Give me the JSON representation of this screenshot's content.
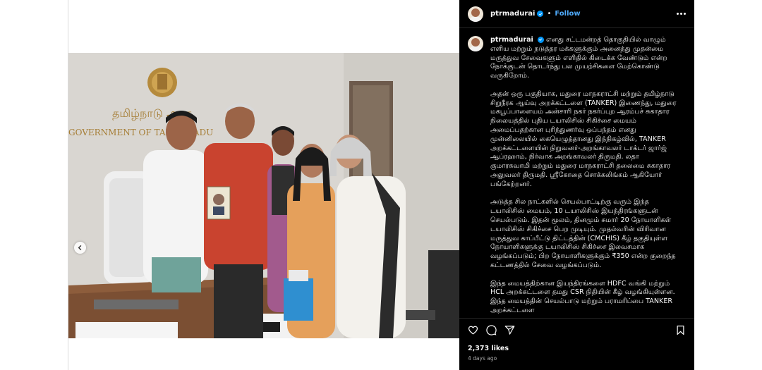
{
  "post": {
    "username": "ptrmadurai",
    "follow_label": "Follow",
    "separator": "•",
    "more_label": "More options"
  },
  "photo": {
    "wall_sign_tamil": "தமிழ்நாடு அரசு",
    "wall_sign_english": "GOVERNMENT OF TAMIL NADU"
  },
  "caption": {
    "username": "ptrmadurai",
    "paragraphs": [
      "எனது சட்டமன்றத் தொகுதியில் வாழும் எளிய மற்றும் நடுத்தர மக்களுக்கும் அனைத்து முதன்மை மருத்துவ சேவைகளும் எளிதில் கிடைக்க வேண்டும் என்ற நோக்குடன் தொடர்ந்து பல முயற்சிகளை மேற்கொண்டு வருகிறோம்.",
      "அதன் ஒரு பகுதியாக, மதுரை மாநகராட்சி மற்றும் தமிழ்நாடு சிறுநீரக ஆய்வு அறக்கட்டளை (TANKER) இணைந்து, மதுரை மகபூப்பாளையம் அன்சாரி நகர் நகர்ப்புற ஆரம்பச் சுகாதார நிலையத்தில் புதிய டயாலிசிஸ் சிகிச்சை மையம் அமைப்பதற்கான புரிந்துணர்வு ஒப்பந்தம் எனது முன்னிலையில் கையெழுத்தானது இந்நிகழ்வில், TANKER அறக்கட்டளையின் நிறுவனர்-அறங்காவலர் டாக்டர் ஜார்ஜ் ஆப்ரஹாம், நிர்வாக அறங்காவலர் திருமதி. லதா குமாரசுவாமி மற்றும் மதுரை மாநகராட்சி தலைமை சுகாதார அலுவலர் திருமதி. ஸ்ரீகோதை சொக்கலிங்கம் ஆகியோர் பங்கேற்றனர்.",
      "அடுத்த சில நாட்களில் செயல்பாட்டிற்கு வரும் இந்த டயாலிசிஸ் மையம், 10 டயாலிசிஸ் இயந்திரங்களுடன் செயல்படும். இதன் மூலம், தினமும் சுமார் 20 நோயாளிகள் டயாலிசிஸ் சிகிச்சை பெற முடியும். முதல்வரின் விரிவான மருத்துவ காப்பீட்டு திட்டத்தின் (CMCHIS) கீழ் தகுதியுள்ள நோயாளிகளுக்கு டயாலிசிஸ் சிகிச்சை இலவசமாக வழங்கப்படும்; பிற நோயாளிகளுக்கும் ₹350 என்ற குறைந்த கட்டணத்தில் சேவை வழங்கப்படும்.",
      "இந்த மையத்திற்கான இயந்திரங்களை HDFC வங்கி மற்றும் HCL அறக்கட்டளை தமது CSR நிதியின் கீழ் வழங்கியுள்ளன. இந்த மையத்தின் செயல்பாடு மற்றும் பராமரிப்பை TANKER அறக்கட்டளை"
    ]
  },
  "engagement": {
    "likes": "2,373 likes",
    "time_ago": "4 days ago"
  },
  "icons": [
    "chevron-left-icon",
    "verified-badge-icon",
    "more-options-icon",
    "heart-icon",
    "comment-icon",
    "share-icon",
    "bookmark-icon"
  ],
  "colors": {
    "panel_bg": "#000000",
    "follow_blue": "#4ea8f7",
    "verified_blue": "#0095f6",
    "muted_text": "#a8a8a8"
  }
}
